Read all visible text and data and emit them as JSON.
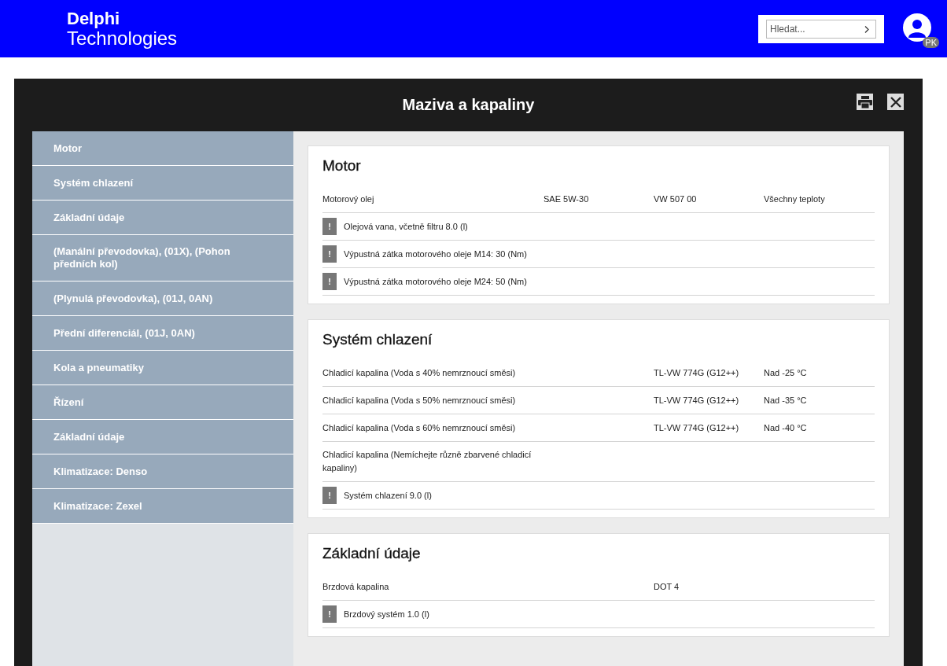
{
  "brand": {
    "line_1": "Delphi",
    "line_2": "Technologies"
  },
  "search": {
    "placeholder": "Hledat..."
  },
  "user": {
    "initials": "PK"
  },
  "dialog": {
    "title": "Maziva a kapaliny"
  },
  "sidebar": {
    "items": [
      {
        "label": "Motor"
      },
      {
        "label": "Systém chlazení"
      },
      {
        "label": "Základní údaje"
      },
      {
        "label": "(Manální převodovka), (01X), (Pohon předních kol)"
      },
      {
        "label": "(Plynulá převodovka), (01J, 0AN)"
      },
      {
        "label": "Přední diferenciál, (01J, 0AN)"
      },
      {
        "label": "Kola a pneumatiky"
      },
      {
        "label": "Řízení"
      },
      {
        "label": "Základní údaje"
      },
      {
        "label": "Klimatizace: Denso"
      },
      {
        "label": "Klimatizace: Zexel"
      }
    ]
  },
  "sections": [
    {
      "title": "Motor",
      "rows": [
        {
          "kind": "spec",
          "fluid": "Motorový olej",
          "viscosity": "SAE 5W-30",
          "specification": "VW 507 00",
          "temperature": "Všechny teploty"
        },
        {
          "kind": "note",
          "badge": "!",
          "text": "Olejová vana, včetně filtru 8.0 (l)"
        },
        {
          "kind": "note",
          "badge": "!",
          "text": "Výpustná zátka motorového oleje M14: 30 (Nm)"
        },
        {
          "kind": "note",
          "badge": "!",
          "text": "Výpustná zátka motorového oleje M24: 50 (Nm)"
        }
      ]
    },
    {
      "title": "Systém chlazení",
      "rows": [
        {
          "kind": "spec",
          "fluid": "Chladicí kapalina (Voda s 40% nemrznoucí směsi)",
          "specification": "TL-VW 774G (G12++)",
          "temperature": "Nad -25 °C"
        },
        {
          "kind": "spec",
          "fluid": "Chladicí kapalina (Voda s 50% nemrznoucí směsi)",
          "specification": "TL-VW 774G (G12++)",
          "temperature": "Nad -35 °C"
        },
        {
          "kind": "spec",
          "fluid": "Chladicí kapalina (Voda s 60% nemrznoucí směsi)",
          "specification": "TL-VW 774G (G12++)",
          "temperature": "Nad -40 °C"
        },
        {
          "kind": "spec",
          "fluid": "Chladicí kapalina (Nemíchejte různě zbarvené chladicí kapaliny)"
        },
        {
          "kind": "note",
          "badge": "!",
          "text": "Systém chlazení 9.0 (l)"
        }
      ]
    },
    {
      "title": "Základní údaje",
      "rows": [
        {
          "kind": "spec",
          "fluid": "Brzdová kapalina",
          "specification": "DOT 4"
        },
        {
          "kind": "note",
          "badge": "!",
          "text": "Brzdový systém 1.0 (l)"
        }
      ]
    }
  ]
}
